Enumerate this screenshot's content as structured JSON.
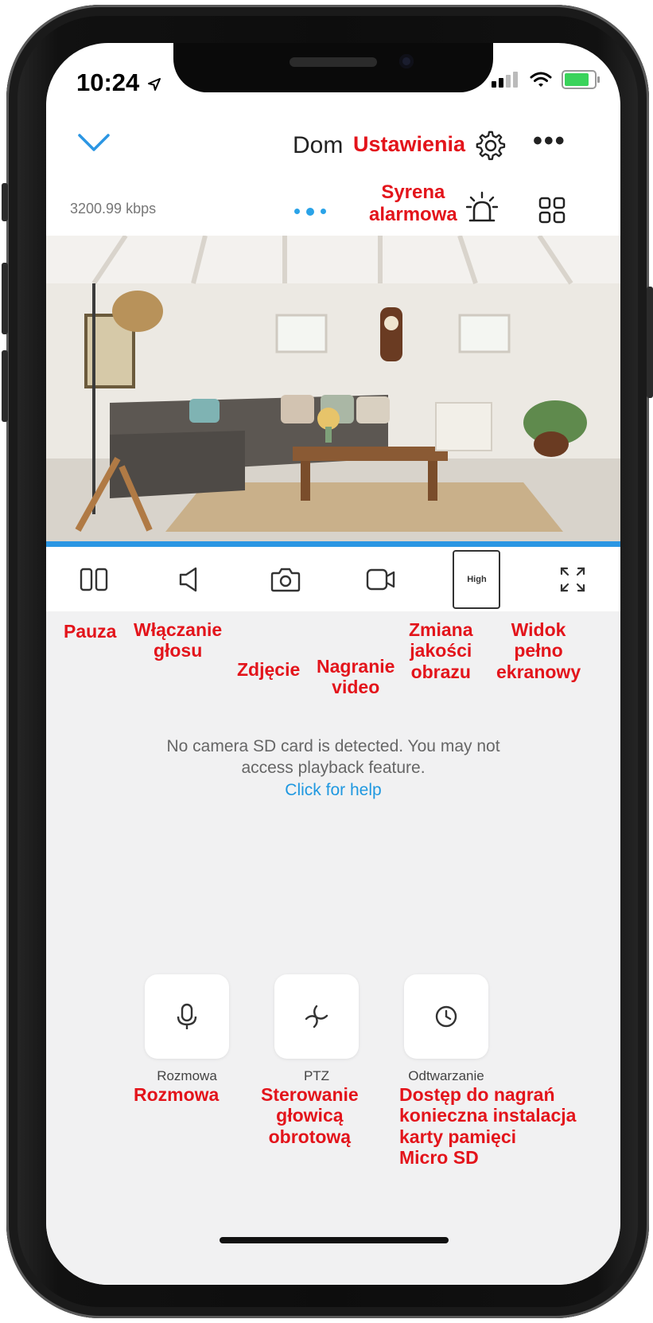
{
  "status": {
    "time": "10:24"
  },
  "header": {
    "title": "Dom",
    "settings_annotation": "Ustawienia"
  },
  "toolbar": {
    "bitrate": "3200.99 kbps",
    "siren_annotation_line1": "Syrena",
    "siren_annotation_line2": "alarmowa",
    "quality_badge": "High"
  },
  "annotations": {
    "pause": "Pauza",
    "audio_line1": "Włączanie",
    "audio_line2": "głosu",
    "photo": "Zdjęcie",
    "record_line1": "Nagranie",
    "record_line2": "video",
    "quality_line1": "Zmiana",
    "quality_line2": "jakości",
    "quality_line3": "obrazu",
    "fullscreen_line1": "Widok",
    "fullscreen_line2": "pełno",
    "fullscreen_line3": "ekranowy"
  },
  "sd_card": {
    "message_line1": "No camera SD card is detected. You may not",
    "message_line2": "access playback feature.",
    "help_link": "Click for help"
  },
  "actions": [
    {
      "label": "Rozmowa",
      "annotation_lines": [
        "Rozmowa"
      ]
    },
    {
      "label": "PTZ",
      "annotation_lines": [
        "Sterowanie",
        "głowicą",
        "obrotową"
      ]
    },
    {
      "label": "Odtwarzanie",
      "annotation_lines": [
        "Dostęp do nagrań",
        "konieczna instalacja",
        "karty pamięci",
        "Micro SD"
      ]
    }
  ],
  "colors": {
    "accent": "#2b96e3",
    "annotation": "#e3141b"
  }
}
